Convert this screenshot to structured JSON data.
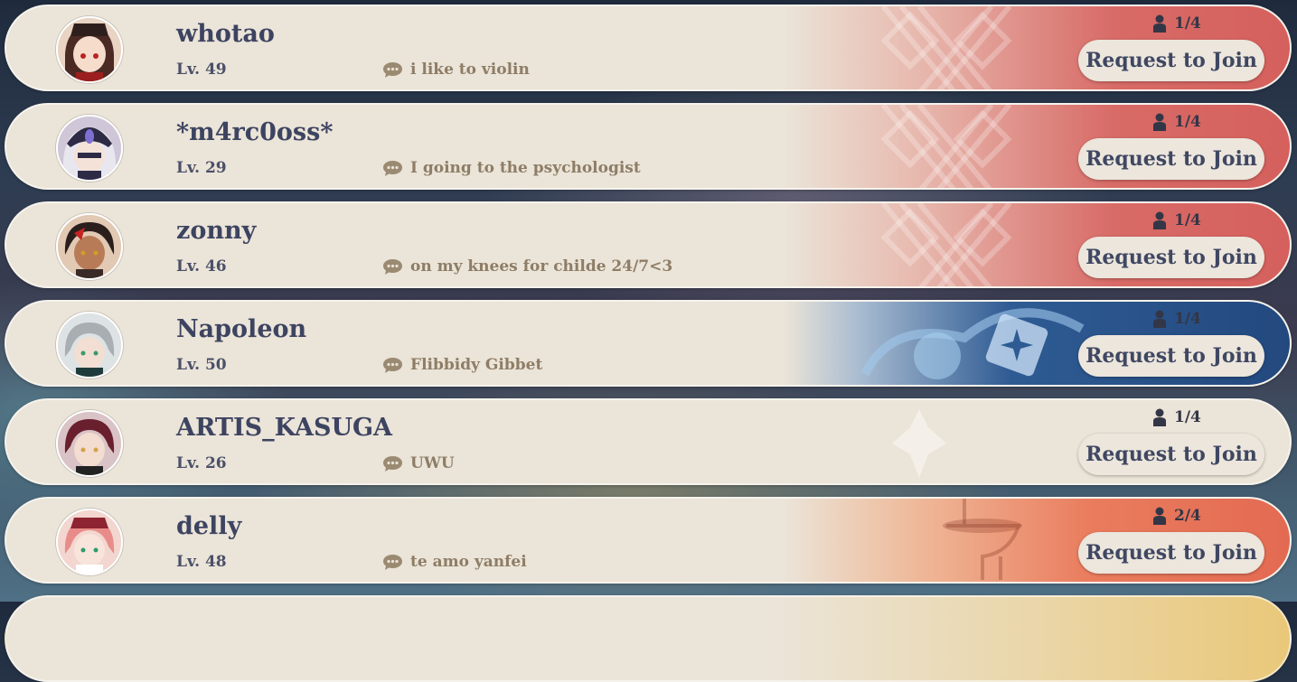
{
  "join_label": "Request to Join",
  "rows": [
    {
      "name": "whotao",
      "level": "Lv. 49",
      "signature": "i like to violin",
      "players": "1/4",
      "theme": "red"
    },
    {
      "name": "*m4rc0oss*",
      "level": "Lv. 29",
      "signature": "I going to the psychologist",
      "players": "1/4",
      "theme": "red"
    },
    {
      "name": "zonny",
      "level": "Lv. 46",
      "signature": "on my knees for childe 24/7<3",
      "players": "1/4",
      "theme": "red"
    },
    {
      "name": "Napoleon",
      "level": "Lv. 50",
      "signature": "Flibbidy Gibbet",
      "players": "1/4",
      "theme": "blue"
    },
    {
      "name": "ARTIS_KASUGA",
      "level": "Lv. 26",
      "signature": "UWU",
      "players": "1/4",
      "theme": "plain"
    },
    {
      "name": "delly",
      "level": "Lv. 48",
      "signature": "te amo yanfei",
      "players": "2/4",
      "theme": "fire"
    }
  ],
  "colors": {
    "card_bg": "#ebe4d8",
    "text_dark": "#3d4461",
    "signature_text": "#8e7d66"
  },
  "icons": {
    "player_count": "person-icon",
    "signature": "chat-bubble-icon"
  }
}
